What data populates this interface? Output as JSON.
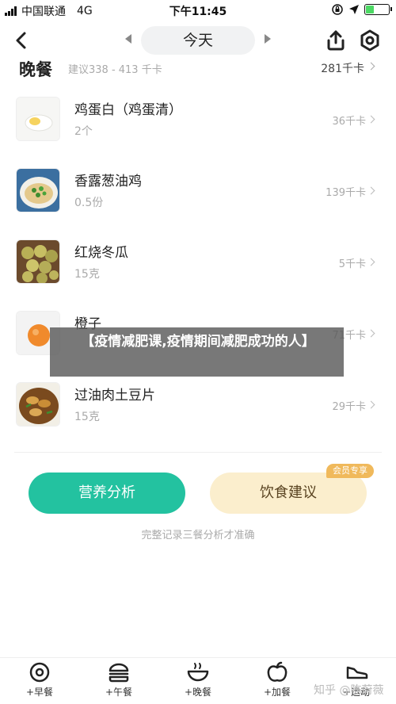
{
  "status_bar": {
    "carrier": "中国联通",
    "network": "4G",
    "time": "下午11:45"
  },
  "nav": {
    "day_label": "今天"
  },
  "meal": {
    "title": "晚餐",
    "suggestion": "建议338 - 413 千卡",
    "total": "281千卡"
  },
  "foods": [
    {
      "name": "鸡蛋白（鸡蛋清）",
      "portion": "2个",
      "kcal": "36千卡",
      "thumb": "egg-white"
    },
    {
      "name": "香露葱油鸡",
      "portion": "0.5份",
      "kcal": "139千卡",
      "thumb": "scallion-chicken"
    },
    {
      "name": "红烧冬瓜",
      "portion": "15克",
      "kcal": "5千卡",
      "thumb": "braised-winter-melon"
    },
    {
      "name": "橙子",
      "portion": "",
      "kcal": "71千卡",
      "thumb": "orange"
    },
    {
      "name": "过油肉土豆片",
      "portion": "15克",
      "kcal": "29千卡",
      "thumb": "pork-potato"
    }
  ],
  "actions": {
    "analysis_label": "营养分析",
    "diet_label": "饮食建议",
    "member_badge": "会员专享",
    "hint": "完整记录三餐分析才准确"
  },
  "overlay": {
    "text": "【疫情减肥课,疫情期间减肥成功的人】"
  },
  "tabs": [
    {
      "label": "+早餐",
      "icon": "breakfast-icon"
    },
    {
      "label": "+午餐",
      "icon": "lunch-icon"
    },
    {
      "label": "+晚餐",
      "icon": "dinner-icon"
    },
    {
      "label": "+加餐",
      "icon": "snack-icon"
    },
    {
      "label": "+运动",
      "icon": "exercise-icon"
    }
  ],
  "watermark": "知乎 @陈蔚薇",
  "colors": {
    "accent_green": "#23c2a0",
    "diet_button_bg": "#fbeecd",
    "member_badge": "#f0b95b"
  }
}
